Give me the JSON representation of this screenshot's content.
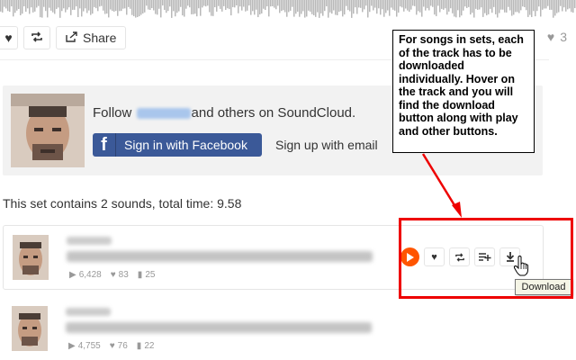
{
  "header": {
    "share_label": "Share",
    "like_count": "3"
  },
  "follow_box": {
    "follow_prefix": "Follow",
    "follow_suffix": "and others on SoundCloud.",
    "facebook_icon": "f",
    "facebook_button": "Sign in with Facebook",
    "signup_link": "Sign up with email"
  },
  "set_info": "This set contains 2 sounds, total time: 9.58",
  "tracks": [
    {
      "plays": "6,428",
      "likes": "83",
      "comments": "25"
    },
    {
      "plays": "4,755",
      "likes": "76",
      "comments": "22"
    }
  ],
  "tooltip": "Download",
  "annotation": "For songs in sets, each of the track has to be downloaded individually. Hover on the track and you will find the download button along with play and other buttons.",
  "icons": {
    "heart": "heart-icon",
    "repost": "repost-icon",
    "share": "share-icon",
    "play": "play-icon",
    "add_to_playlist": "add-to-playlist-icon",
    "download": "download-icon"
  },
  "colors": {
    "brand_orange": "#ff5500",
    "facebook_blue": "#3b5998",
    "annotation_red": "#ee0000"
  }
}
